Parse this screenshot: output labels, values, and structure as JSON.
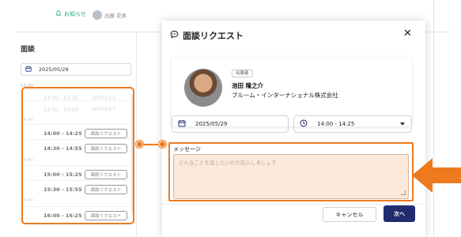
{
  "app": {
    "notifications_label": "お知らせ",
    "user_name": "出展 花男",
    "left_title": "面談",
    "date": "2025/05/29",
    "time_labels": [
      "13:00",
      "14:00",
      "15:00",
      "16:00"
    ],
    "slots": [
      {
        "time": "13:00 - 13:25",
        "status": "時間予定あり",
        "button": ""
      },
      {
        "time": "13:30 - 13:55",
        "status": "時間予定あり",
        "button": ""
      },
      {
        "time": "14:00 - 14:25",
        "status": "",
        "button": "面談リクエスト"
      },
      {
        "time": "14:30 - 14:55",
        "status": "",
        "button": "面談リクエスト"
      },
      {
        "time": "15:00 - 15:25",
        "status": "",
        "button": "面談リクエスト"
      },
      {
        "time": "15:30 - 15:55",
        "status": "",
        "button": "面談リクエスト"
      },
      {
        "time": "16:00 - 16:25",
        "status": "",
        "button": "面談リクエスト"
      }
    ]
  },
  "modal": {
    "title": "面談リクエスト",
    "close": "✕",
    "exhibitor": {
      "role_badge": "出展者",
      "name": "池田 隆之介",
      "company": "ブルーム・インターナショナル株式会社"
    },
    "date": "2025/05/29",
    "time": "14:00 - 14:25",
    "message_label": "メッセージ",
    "message_placeholder": "どんなことを話したいのか記入しましょう",
    "cancel_label": "キャンセル",
    "next_label": "次へ"
  },
  "colors": {
    "highlight": "#ee7a1e",
    "primary": "#1f2d6e",
    "accent": "#2ba58a",
    "textarea_bg": "#fbeadc"
  },
  "icons": [
    "bell-icon",
    "chat-bubble-icon",
    "calendar-icon",
    "clock-icon",
    "close-icon"
  ]
}
